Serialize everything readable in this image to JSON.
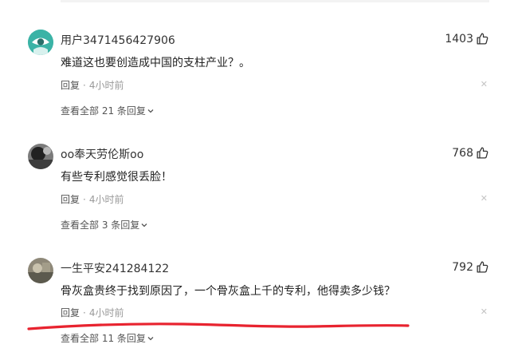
{
  "comments": [
    {
      "username": "用户3471456427906",
      "text": "难道这也要创造成中国的支柱产业？。",
      "likes": "1403",
      "reply_label": "回复",
      "separator": "·",
      "time": "4小时前",
      "view_replies": "查看全部 21 条回复",
      "avatar_icon": "default-avatar-icon"
    },
    {
      "username": "oo奉天劳伦斯oo",
      "text": "有些专利感觉很丢脸！",
      "likes": "768",
      "reply_label": "回复",
      "separator": "·",
      "time": "4小时前",
      "view_replies": "查看全部 3 条回复",
      "avatar_icon": "user-photo-avatar"
    },
    {
      "username": "一生平安241284122",
      "text": "骨灰盒贵终于找到原因了，一个骨灰盒上千的专利，他得卖多少钱？",
      "likes": "792",
      "reply_label": "回复",
      "separator": "·",
      "time": "4小时前",
      "view_replies": "查看全部 11 条回复",
      "avatar_icon": "user-photo-avatar"
    }
  ],
  "icons": {
    "like": "thumbs-up-icon",
    "close": "close-icon",
    "expand": "chevron-down-icon"
  },
  "colors": {
    "annotation_line": "#e8232f",
    "time_text": "#999999",
    "default_avatar_bg": "#3bb3a6"
  }
}
